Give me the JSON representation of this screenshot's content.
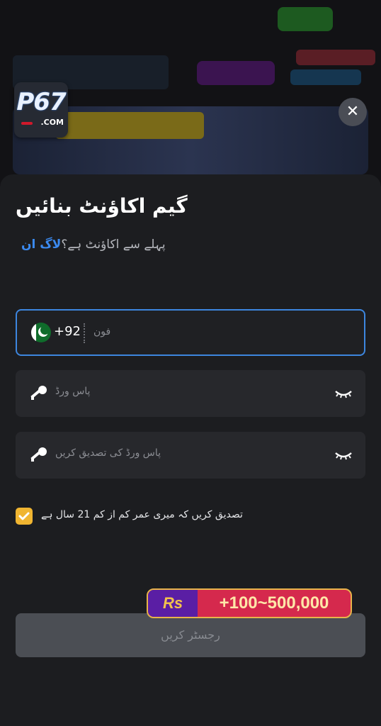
{
  "logo": {
    "main": "P67",
    "suffix": ".COM"
  },
  "close_label": "✕",
  "form": {
    "title": "گیم اکاؤنٹ بنائیں",
    "subtitle_text": "پہلے سے اکاؤنٹ ہے؟",
    "login_link": "لاگ ان",
    "phone": {
      "code": "+92",
      "placeholder": "فون",
      "flag": "pakistan-flag-icon"
    },
    "password": {
      "placeholder": "پاس ورڈ"
    },
    "confirm_password": {
      "placeholder": "پاس ورڈ کی تصدیق کریں"
    },
    "age_confirm": "تصدیق کریں کہ میری عمر کم از کم 21 سال ہے",
    "age_checked": true,
    "register_button": "رجسٹر کریں"
  },
  "bonus": {
    "currency": "Rs",
    "amount": "+100~500,000"
  },
  "colors": {
    "accent": "#3d86df",
    "check": "#f0b531",
    "bonus_pink": "#d5294d",
    "bonus_purple": "#5a1ea4"
  }
}
